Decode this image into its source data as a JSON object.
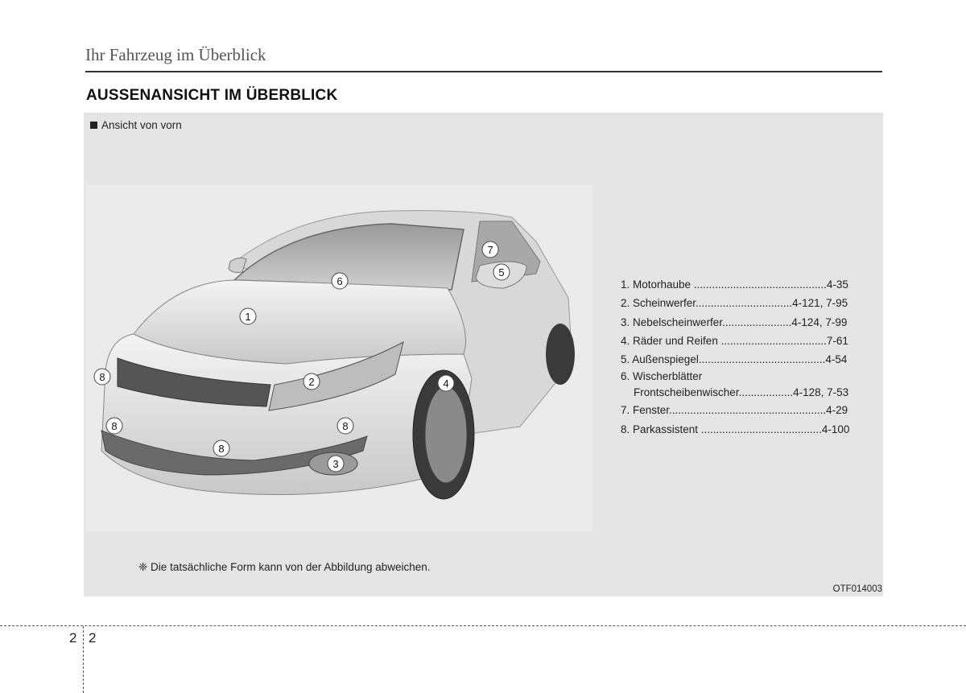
{
  "header": {
    "section": "Ihr Fahrzeug im Überblick"
  },
  "title": "AUSSENANSICHT IM ÜBERBLICK",
  "caption": "Ansicht von vorn",
  "callouts": [
    "1",
    "2",
    "3",
    "4",
    "5",
    "6",
    "7",
    "8"
  ],
  "legend": {
    "items": [
      "1. Motorhaube ............................................4-35",
      "2. Scheinwerfer................................4-121, 7-95",
      "3. Nebelscheinwerfer.......................4-124, 7-99",
      "4. Räder und Reifen ...................................7-61",
      "5. Außenspiegel..........................................4-54",
      "6. Wischerblätter",
      "Frontscheibenwischer..................4-128, 7-53",
      "7. Fenster....................................................4-29",
      "8. Parkassistent ........................................4-100"
    ]
  },
  "note": "❈ Die tatsächliche Form kann von der Abbildung abweichen.",
  "figure_code": "OTF014003",
  "page": {
    "chapter": "2",
    "number": "2"
  }
}
